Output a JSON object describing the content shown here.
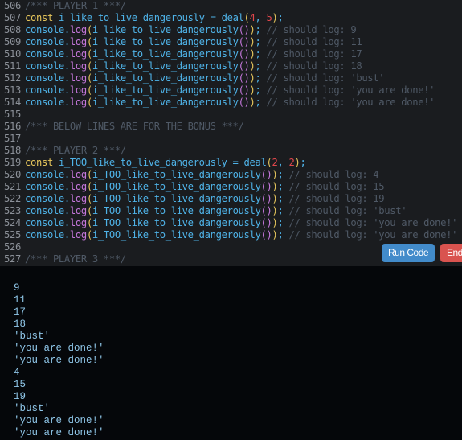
{
  "editor": {
    "lines": [
      {
        "n": "506",
        "type": "comment",
        "text": "/*** PLAYER 1 ***/"
      },
      {
        "n": "507",
        "type": "const",
        "name": "i_like_to_live_dangerously",
        "a": "4",
        "b": "5"
      },
      {
        "n": "508",
        "type": "log",
        "name": "i_like_to_live_dangerously",
        "comment": "// should log: 9"
      },
      {
        "n": "509",
        "type": "log",
        "name": "i_like_to_live_dangerously",
        "comment": "// should log: 11"
      },
      {
        "n": "510",
        "type": "log",
        "name": "i_like_to_live_dangerously",
        "comment": "// should log: 17"
      },
      {
        "n": "511",
        "type": "log",
        "name": "i_like_to_live_dangerously",
        "comment": "// should log: 18"
      },
      {
        "n": "512",
        "type": "log",
        "name": "i_like_to_live_dangerously",
        "comment": "// should log: 'bust'"
      },
      {
        "n": "513",
        "type": "log",
        "name": "i_like_to_live_dangerously",
        "comment": "// should log: 'you are done!'"
      },
      {
        "n": "514",
        "type": "log",
        "name": "i_like_to_live_dangerously",
        "comment": "// should log: 'you are done!'"
      },
      {
        "n": "515",
        "type": "blank",
        "text": ""
      },
      {
        "n": "516",
        "type": "comment",
        "text": "/*** BELOW LINES ARE FOR THE BONUS ***/"
      },
      {
        "n": "517",
        "type": "blank",
        "text": ""
      },
      {
        "n": "518",
        "type": "comment",
        "text": "/*** PLAYER 2 ***/"
      },
      {
        "n": "519",
        "type": "const",
        "name": "i_TOO_like_to_live_dangerously",
        "a": "2",
        "b": "2"
      },
      {
        "n": "520",
        "type": "log",
        "name": "i_TOO_like_to_live_dangerously",
        "comment": "// should log: 4"
      },
      {
        "n": "521",
        "type": "log",
        "name": "i_TOO_like_to_live_dangerously",
        "comment": "// should log: 15"
      },
      {
        "n": "522",
        "type": "log",
        "name": "i_TOO_like_to_live_dangerously",
        "comment": "// should log: 19"
      },
      {
        "n": "523",
        "type": "log",
        "name": "i_TOO_like_to_live_dangerously",
        "comment": "// should log: 'bust'"
      },
      {
        "n": "524",
        "type": "log",
        "name": "i_TOO_like_to_live_dangerously",
        "comment": "// should log: 'you are done!'"
      },
      {
        "n": "525",
        "type": "log",
        "name": "i_TOO_like_to_live_dangerously",
        "comment": "// should log: 'you are done!'"
      },
      {
        "n": "526",
        "type": "blank",
        "text": ""
      },
      {
        "n": "527",
        "type": "comment",
        "text": "/*** PLAYER 3 ***/"
      }
    ],
    "tokens": {
      "const_kw": "const",
      "deal_fn": "deal",
      "console": "console",
      "log": "log"
    }
  },
  "buttons": {
    "run": "Run Code",
    "end": "End"
  },
  "output": {
    "lines": [
      "9",
      "11",
      "17",
      "18",
      "'bust'",
      "'you are done!'",
      "'you are done!'",
      "4",
      "15",
      "19",
      "'bust'",
      "'you are done!'",
      "'you are done!'"
    ]
  }
}
